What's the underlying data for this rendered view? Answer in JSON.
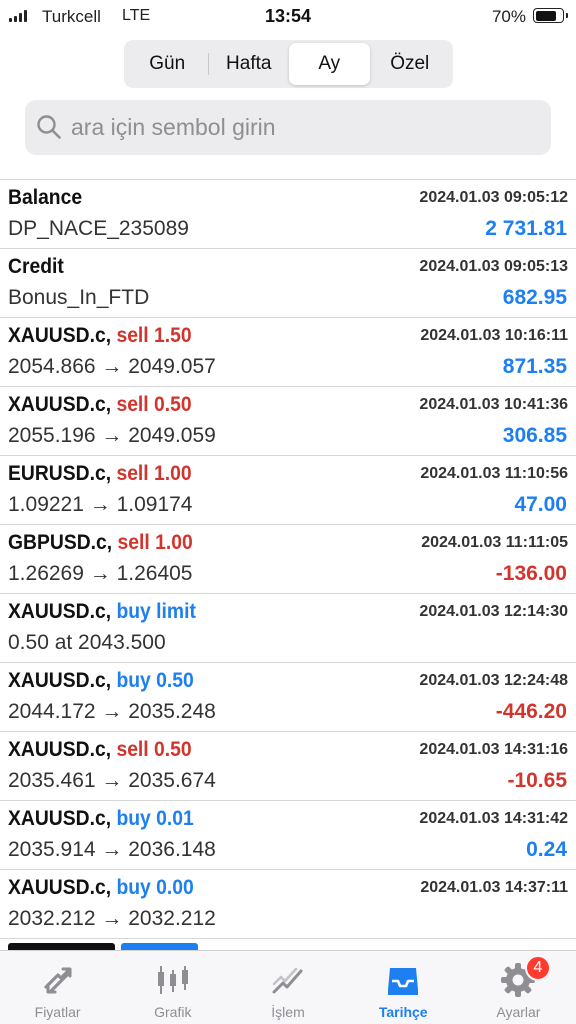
{
  "status_bar": {
    "carrier": "Turkcell",
    "network": "LTE",
    "time": "13:54",
    "battery": "70%",
    "battery_level": 0.7
  },
  "period_tabs": [
    {
      "label": "Gün",
      "active": false
    },
    {
      "label": "Hafta",
      "active": false
    },
    {
      "label": "Ay",
      "active": true
    },
    {
      "label": "Özel",
      "active": false
    }
  ],
  "search": {
    "placeholder": "ara için sembol girin",
    "value": ""
  },
  "colors": {
    "accent": "#1d7ff0",
    "negative": "#d2352d",
    "badge": "#ff3b30"
  },
  "history": [
    {
      "symbol": "Balance",
      "action": "",
      "action_type": "",
      "detail": "DP_NACE_235089",
      "time": "2024.01.03 09:05:12",
      "amount": "2 731.81",
      "amount_sign": "pos"
    },
    {
      "symbol": "Credit",
      "action": "",
      "action_type": "",
      "detail": "Bonus_In_FTD",
      "time": "2024.01.03 09:05:13",
      "amount": "682.95",
      "amount_sign": "pos"
    },
    {
      "symbol": "XAUUSD.c,",
      "action": "sell 1.50",
      "action_type": "sell",
      "detail": "2054.866 → 2049.057",
      "time": "2024.01.03 10:16:11",
      "amount": "871.35",
      "amount_sign": "pos"
    },
    {
      "symbol": "XAUUSD.c,",
      "action": "sell 0.50",
      "action_type": "sell",
      "detail": "2055.196 → 2049.059",
      "time": "2024.01.03 10:41:36",
      "amount": "306.85",
      "amount_sign": "pos"
    },
    {
      "symbol": "EURUSD.c,",
      "action": "sell 1.00",
      "action_type": "sell",
      "detail": "1.09221 → 1.09174",
      "time": "2024.01.03 11:10:56",
      "amount": "47.00",
      "amount_sign": "pos"
    },
    {
      "symbol": "GBPUSD.c,",
      "action": "sell 1.00",
      "action_type": "sell",
      "detail": "1.26269 → 1.26405",
      "time": "2024.01.03 11:11:05",
      "amount": "-136.00",
      "amount_sign": "neg"
    },
    {
      "symbol": "XAUUSD.c,",
      "action": "buy limit",
      "action_type": "buy",
      "detail": "0.50 at 2043.500",
      "time": "2024.01.03 12:14:30",
      "amount": "",
      "amount_sign": "pos"
    },
    {
      "symbol": "XAUUSD.c,",
      "action": "buy 0.50",
      "action_type": "buy",
      "detail": "2044.172 → 2035.248",
      "time": "2024.01.03 12:24:48",
      "amount": "-446.20",
      "amount_sign": "neg"
    },
    {
      "symbol": "XAUUSD.c,",
      "action": "sell 0.50",
      "action_type": "sell",
      "detail": "2035.461 → 2035.674",
      "time": "2024.01.03 14:31:16",
      "amount": "-10.65",
      "amount_sign": "neg"
    },
    {
      "symbol": "XAUUSD.c,",
      "action": "buy 0.01",
      "action_type": "buy",
      "detail": "2035.914 → 2036.148",
      "time": "2024.01.03 14:31:42",
      "amount": "0.24",
      "amount_sign": "pos"
    },
    {
      "symbol": "XAUUSD.c,",
      "action": "buy 0.00",
      "action_type": "buy",
      "detail": "2032.212 → 2032.212",
      "time": "2024.01.03 14:37:11",
      "amount": "",
      "amount_sign": "pos"
    }
  ],
  "tab_bar": [
    {
      "label": "Fiyatlar",
      "icon": "quotes-icon",
      "active": false,
      "badge": ""
    },
    {
      "label": "Grafik",
      "icon": "chart-icon",
      "active": false,
      "badge": ""
    },
    {
      "label": "İşlem",
      "icon": "trade-icon",
      "active": false,
      "badge": ""
    },
    {
      "label": "Tarihçe",
      "icon": "history-icon",
      "active": true,
      "badge": ""
    },
    {
      "label": "Ayarlar",
      "icon": "settings-icon",
      "active": false,
      "badge": "4"
    }
  ]
}
